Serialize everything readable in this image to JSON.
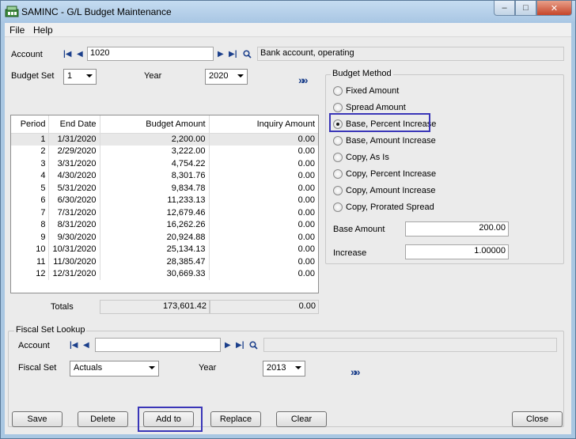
{
  "window": {
    "title": "SAMINC - G/L Budget Maintenance",
    "minimize": "–",
    "maximize": "□",
    "close": "✕"
  },
  "menu": {
    "file": "File",
    "help": "Help"
  },
  "account": {
    "label": "Account",
    "value": "1020",
    "description": "Bank account, operating"
  },
  "budget_set": {
    "label": "Budget Set",
    "value": "1"
  },
  "year": {
    "label": "Year",
    "value": "2020"
  },
  "grid": {
    "headers": [
      "Period",
      "End Date",
      "Budget Amount",
      "Inquiry Amount"
    ],
    "rows": [
      {
        "period": "1",
        "end_date": "1/31/2020",
        "budget": "2,200.00",
        "inquiry": "0.00"
      },
      {
        "period": "2",
        "end_date": "2/29/2020",
        "budget": "3,222.00",
        "inquiry": "0.00"
      },
      {
        "period": "3",
        "end_date": "3/31/2020",
        "budget": "4,754.22",
        "inquiry": "0.00"
      },
      {
        "period": "4",
        "end_date": "4/30/2020",
        "budget": "8,301.76",
        "inquiry": "0.00"
      },
      {
        "period": "5",
        "end_date": "5/31/2020",
        "budget": "9,834.78",
        "inquiry": "0.00"
      },
      {
        "period": "6",
        "end_date": "6/30/2020",
        "budget": "11,233.13",
        "inquiry": "0.00"
      },
      {
        "period": "7",
        "end_date": "7/31/2020",
        "budget": "12,679.46",
        "inquiry": "0.00"
      },
      {
        "period": "8",
        "end_date": "8/31/2020",
        "budget": "16,262.26",
        "inquiry": "0.00"
      },
      {
        "period": "9",
        "end_date": "9/30/2020",
        "budget": "20,924.88",
        "inquiry": "0.00"
      },
      {
        "period": "10",
        "end_date": "10/31/2020",
        "budget": "25,134.13",
        "inquiry": "0.00"
      },
      {
        "period": "11",
        "end_date": "11/30/2020",
        "budget": "28,385.47",
        "inquiry": "0.00"
      },
      {
        "period": "12",
        "end_date": "12/31/2020",
        "budget": "30,669.33",
        "inquiry": "0.00"
      }
    ]
  },
  "totals": {
    "label": "Totals",
    "budget": "173,601.42",
    "inquiry": "0.00"
  },
  "budget_method": {
    "title": "Budget Method",
    "options": [
      {
        "label": "Fixed Amount",
        "checked": false
      },
      {
        "label": "Spread Amount",
        "checked": false
      },
      {
        "label": "Base, Percent Increase",
        "checked": true
      },
      {
        "label": "Base, Amount Increase",
        "checked": false
      },
      {
        "label": "Copy, As Is",
        "checked": false
      },
      {
        "label": "Copy, Percent Increase",
        "checked": false
      },
      {
        "label": "Copy, Amount Increase",
        "checked": false
      },
      {
        "label": "Copy, Prorated Spread",
        "checked": false
      }
    ],
    "base_amount_label": "Base Amount",
    "base_amount": "200.00",
    "increase_label": "Increase",
    "increase": "1.00000"
  },
  "fiscal_lookup": {
    "title": "Fiscal Set Lookup",
    "account_label": "Account",
    "account_value": "",
    "fiscal_set_label": "Fiscal Set",
    "fiscal_set_value": "Actuals",
    "year_label": "Year",
    "year_value": "2013"
  },
  "buttons": {
    "save": "Save",
    "delete": "Delete",
    "add_to": "Add to",
    "replace": "Replace",
    "clear": "Clear",
    "close": "Close"
  },
  "colors": {
    "highlight": "#3a36b8",
    "titlebar": "#a8c6e3"
  }
}
